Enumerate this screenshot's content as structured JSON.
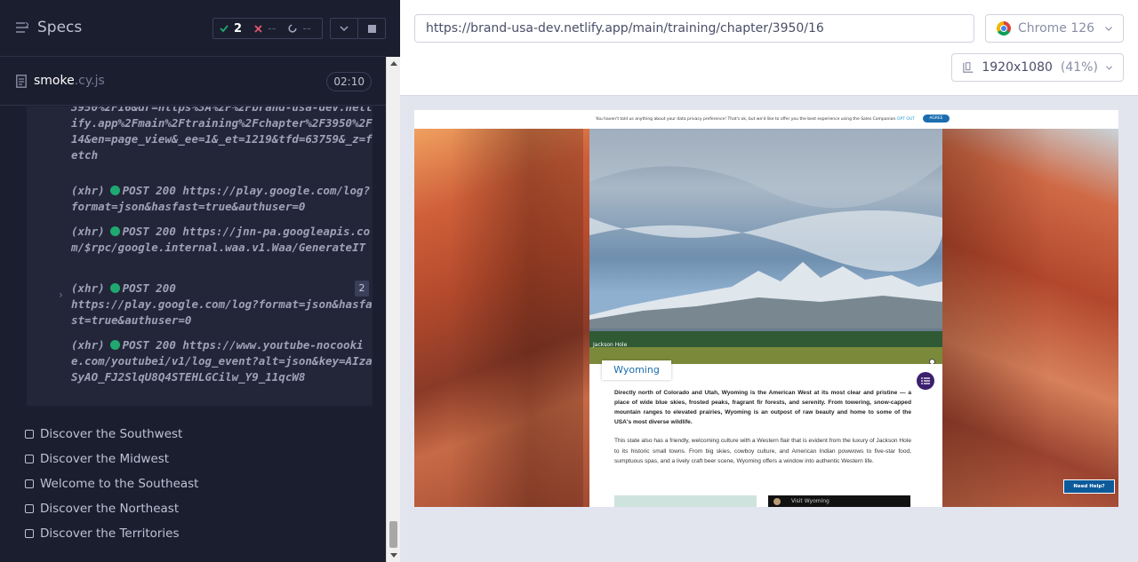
{
  "reporter": {
    "title": "Specs",
    "stats": {
      "passed": "2",
      "failed": "--",
      "pending": "--"
    },
    "spec": {
      "name": "smoke",
      "ext": ".cy.js",
      "duration": "02:10"
    },
    "log_entries": [
      {
        "text": "3950%2F16&dr=https%3A%2F%2Fbrand-usa-dev.netlify.app%2Fmain%2Ftraining%2Fchapter%2F3950%2F14&en=page_view&_ee=1&_et=1219&tfd=63759&_z=fetch"
      },
      {
        "kind": "(xhr)",
        "method": "POST 200",
        "url": "https://play.google.com/log?format=json&hasfast=true&authuser=0"
      },
      {
        "kind": "(xhr)",
        "method": "POST 200",
        "url": "https://jnn-pa.googleapis.com/$rpc/google.internal.waa.v1.Waa/GenerateIT"
      },
      {
        "kind": "(xhr)",
        "method": "POST 200",
        "url": "https://play.google.com/log?format=json&hasfast=true&authuser=0",
        "count": "2"
      },
      {
        "kind": "(xhr)",
        "method": "POST 200",
        "url": "https://www.youtube-nocookie.com/youtubei/v1/log_event?alt=json&key=AIzaSyAO_FJ2SlqU8Q4STEHLGCilw_Y9_11qcW8"
      }
    ],
    "tests": [
      "Discover the Southwest",
      "Discover the Midwest",
      "Welcome to the Southeast",
      "Discover the Northeast",
      "Discover the Territories"
    ]
  },
  "preview": {
    "url": "https://brand-usa-dev.netlify.app/main/training/chapter/3950/16",
    "browser": "Chrome 126",
    "viewport": "1920x1080",
    "scale": "(41%)"
  },
  "aut": {
    "consent_message": "You haven't told us anything about your data privacy preference! That's ok, but we'd like to offer you the best experience using the Sales Companion.",
    "opt_out": "OPT OUT",
    "agree": "AGREE",
    "hero_caption": "Jackson Hole",
    "state_name": "Wyoming",
    "lead": "Directly north of Colorado and Utah, Wyoming is the American West at its most clear and pristine — a place of wide blue skies, frosted peaks, fragrant fir forests, and serenity. From towering, snow-capped mountain ranges to elevated prairies, Wyoming is an outpost of raw beauty and home to some of the USA's most diverse wildlife.",
    "body": "This state also has a friendly, welcoming culture with a Western flair that is evident from the luxury of Jackson Hole to its historic small towns. From big skies, cowboy culture, and American Indian powwows to five-star food, sumptuous spas, and a lively craft beer scene, Wyoming offers a window into authentic Western life.",
    "video_title": "Visit Wyoming",
    "help": "Need Help?"
  },
  "colors": {
    "pass": "#1fa971",
    "fail": "#e45770",
    "reporter_bg": "#1b1e2e",
    "accent_blue": "#1b6db0"
  }
}
